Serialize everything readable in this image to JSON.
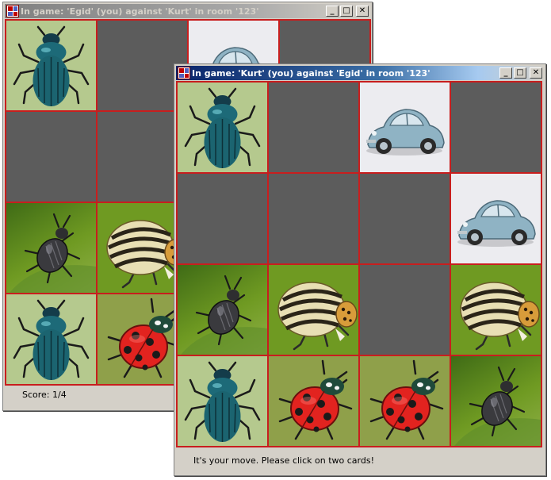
{
  "windows": {
    "back": {
      "title": "In game: 'Egid' (you) against 'Kurt' in room '123'",
      "status": "Score: 1/4",
      "cards": [
        "beetle",
        "hidden",
        "car",
        "hidden",
        "hidden",
        "hidden",
        "hidden",
        "hidden",
        "stag",
        "potato",
        "hidden",
        "hidden",
        "beetle",
        "ladybug",
        "hidden",
        "hidden"
      ]
    },
    "front": {
      "title": "In game: 'Kurt' (you) against 'Egid' in room '123'",
      "status": "It's your move. Please click on two cards!",
      "cards": [
        "beetle",
        "hidden",
        "car",
        "hidden",
        "hidden",
        "hidden",
        "hidden",
        "car",
        "stag",
        "potato",
        "hidden",
        "potato",
        "beetle",
        "ladybug",
        "ladybug",
        "stag"
      ]
    }
  },
  "titlebar_buttons": {
    "minimize": "_",
    "maximize": "□",
    "close": "✕"
  },
  "icons": {
    "app": "memory-game-icon",
    "card_back": "card-back",
    "card_faces": [
      "scarab-beetle-icon",
      "vw-beetle-car-icon",
      "potato-beetle-icon",
      "ladybug-icon",
      "stag-beetle-icon"
    ]
  },
  "colors": {
    "grid_line": "#c81e1e",
    "card_back": "#5c5c5c",
    "active_title": "#0a246a",
    "inactive_title": "#808080"
  }
}
